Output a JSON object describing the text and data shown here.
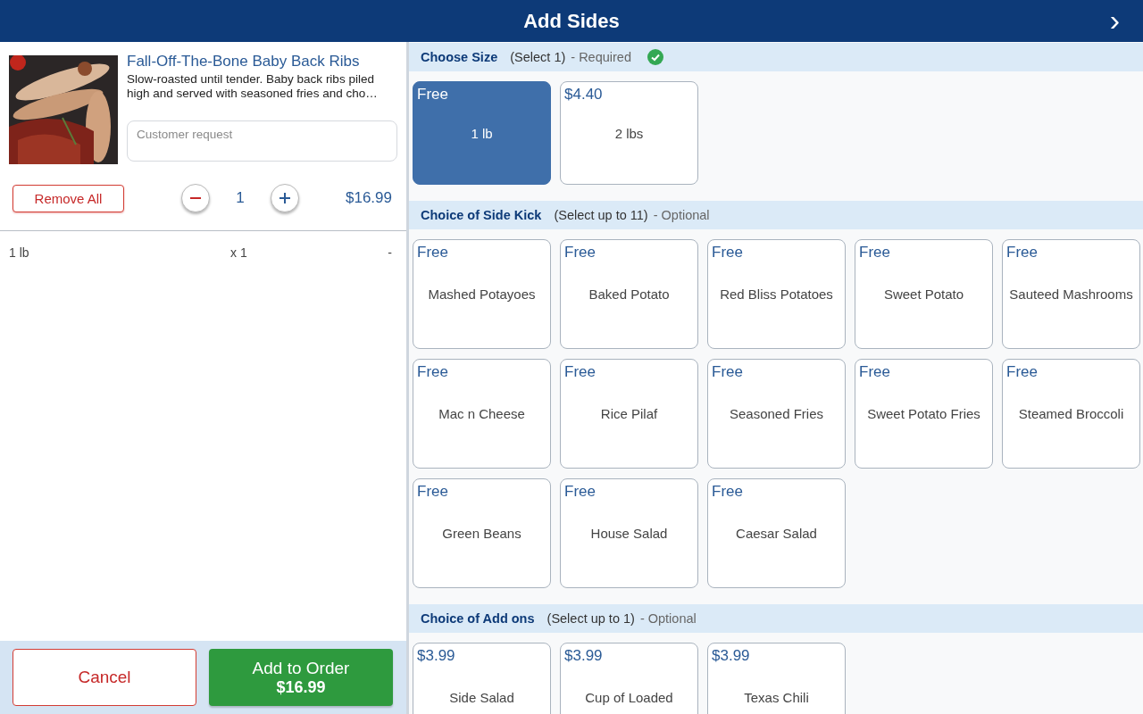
{
  "header": {
    "title": "Add Sides",
    "next_icon": "›"
  },
  "item": {
    "name": "Fall-Off-The-Bone Baby Back Ribs",
    "description": "Slow-roasted until tender. Baby back ribs piled high and served with seasoned fries and cho…",
    "request_placeholder": "Customer request",
    "remove_label": "Remove All",
    "quantity": "1",
    "price": "$16.99"
  },
  "selections": [
    {
      "name": "1 lb",
      "qty": "x 1",
      "price": "-"
    }
  ],
  "footer": {
    "cancel": "Cancel",
    "add_label": "Add to Order",
    "add_price": "$16.99"
  },
  "groups": [
    {
      "title": "Choose Size",
      "rule": "(Select 1)",
      "status": "- Required",
      "complete": true,
      "options": [
        {
          "price": "Free",
          "name": "1 lb",
          "selected": true
        },
        {
          "price": "$4.40",
          "name": "2 lbs",
          "selected": false
        }
      ]
    },
    {
      "title": "Choice of Side Kick",
      "rule": "(Select up to 11)",
      "status": "- Optional",
      "complete": false,
      "options": [
        {
          "price": "Free",
          "name": "Mashed Potayoes",
          "selected": false
        },
        {
          "price": "Free",
          "name": "Baked Potato",
          "selected": false
        },
        {
          "price": "Free",
          "name": "Red Bliss Potatoes",
          "selected": false
        },
        {
          "price": "Free",
          "name": "Sweet Potato",
          "selected": false
        },
        {
          "price": "Free",
          "name": "Sauteed Mashrooms",
          "selected": false
        },
        {
          "price": "Free",
          "name": "Mac n Cheese",
          "selected": false
        },
        {
          "price": "Free",
          "name": "Rice Pilaf",
          "selected": false
        },
        {
          "price": "Free",
          "name": "Seasoned Fries",
          "selected": false
        },
        {
          "price": "Free",
          "name": "Sweet Potato Fries",
          "selected": false
        },
        {
          "price": "Free",
          "name": "Steamed Broccoli",
          "selected": false
        },
        {
          "price": "Free",
          "name": "Green Beans",
          "selected": false
        },
        {
          "price": "Free",
          "name": "House Salad",
          "selected": false
        },
        {
          "price": "Free",
          "name": "Caesar Salad",
          "selected": false
        }
      ]
    },
    {
      "title": "Choice of Add ons",
      "rule": "(Select up to 1)",
      "status": "- Optional",
      "complete": false,
      "options": [
        {
          "price": "$3.99",
          "name": "Side Salad",
          "selected": false
        },
        {
          "price": "$3.99",
          "name": "Cup of Loaded",
          "selected": false
        },
        {
          "price": "$3.99",
          "name": "Texas Chili",
          "selected": false
        }
      ]
    }
  ]
}
